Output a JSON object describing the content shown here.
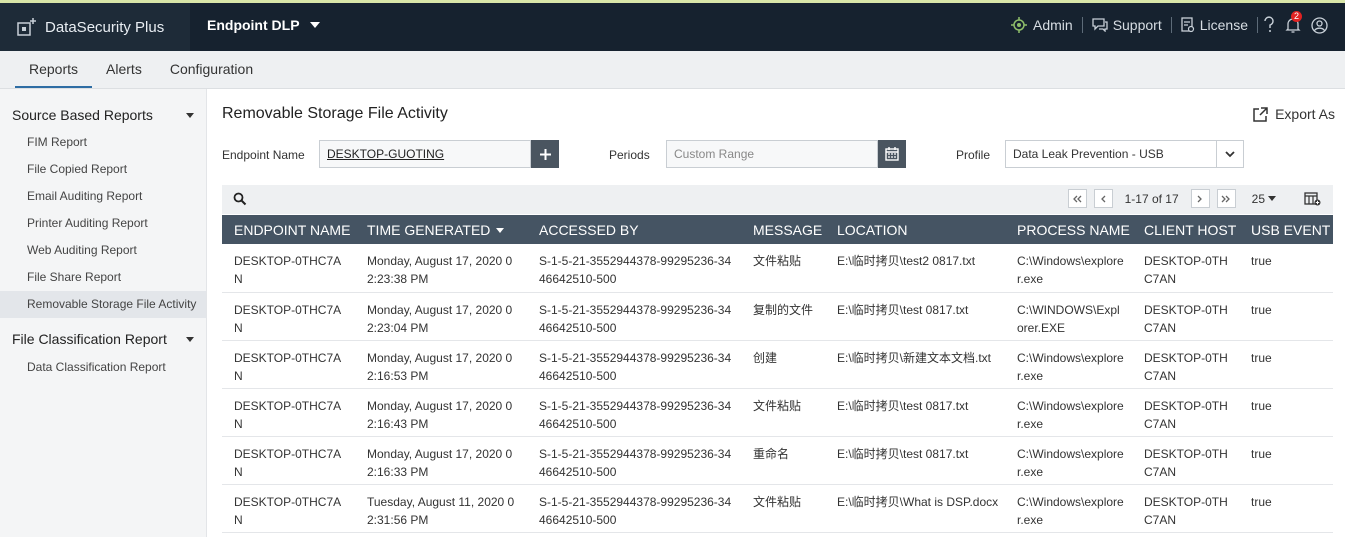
{
  "header": {
    "brand": "DataSecurity Plus",
    "module": "Endpoint DLP",
    "links": [
      {
        "label": "Admin",
        "icon": "admin-gear-icon"
      },
      {
        "label": "Support",
        "icon": "support-chat-icon"
      },
      {
        "label": "License",
        "icon": "license-icon"
      }
    ],
    "notification_count": "2"
  },
  "tabs": [
    {
      "label": "Reports",
      "active": true
    },
    {
      "label": "Alerts",
      "active": false
    },
    {
      "label": "Configuration",
      "active": false
    }
  ],
  "sidebar": {
    "groups": [
      {
        "title": "Source Based Reports",
        "items": [
          {
            "label": "FIM Report"
          },
          {
            "label": "File Copied Report"
          },
          {
            "label": "Email Auditing Report"
          },
          {
            "label": "Printer Auditing Report"
          },
          {
            "label": "Web Auditing Report"
          },
          {
            "label": "File Share Report"
          },
          {
            "label": "Removable Storage File Activity"
          }
        ]
      },
      {
        "title": "File Classification Report",
        "items": [
          {
            "label": "Data Classification Report"
          }
        ]
      }
    ]
  },
  "page": {
    "title": "Removable Storage File Activity",
    "export_label": "Export As"
  },
  "filters": {
    "endpoint_label": "Endpoint Name",
    "endpoint_value": "DESKTOP-GUOTING",
    "periods_label": "Periods",
    "periods_placeholder": "Custom Range",
    "profile_label": "Profile",
    "profile_value": "Data Leak Prevention - USB"
  },
  "pager": {
    "info": "1-17 of 17",
    "page_size": "25"
  },
  "table": {
    "columns": [
      "ENDPOINT NAME",
      "TIME GENERATED",
      "ACCESSED BY",
      "MESSAGE",
      "LOCATION",
      "PROCESS NAME",
      "CLIENT HOST",
      "USB EVENT"
    ],
    "rows": [
      [
        "DESKTOP-0THC7AN",
        "Monday, August 17, 2020 02:23:38 PM",
        "S-1-5-21-3552944378-99295236-3446642510-500",
        "文件粘贴",
        "E:\\临时拷贝\\test2 0817.txt",
        "C:\\Windows\\explorer.exe",
        "DESKTOP-0THC7AN",
        "true"
      ],
      [
        "DESKTOP-0THC7AN",
        "Monday, August 17, 2020 02:23:04 PM",
        "S-1-5-21-3552944378-99295236-3446642510-500",
        "复制的文件",
        "E:\\临时拷贝\\test 0817.txt",
        "C:\\WINDOWS\\Explorer.EXE",
        "DESKTOP-0THC7AN",
        "true"
      ],
      [
        "DESKTOP-0THC7AN",
        "Monday, August 17, 2020 02:16:53 PM",
        "S-1-5-21-3552944378-99295236-3446642510-500",
        "创建",
        "E:\\临时拷贝\\新建文本文档.txt",
        "C:\\Windows\\explorer.exe",
        "DESKTOP-0THC7AN",
        "true"
      ],
      [
        "DESKTOP-0THC7AN",
        "Monday, August 17, 2020 02:16:43 PM",
        "S-1-5-21-3552944378-99295236-3446642510-500",
        "文件粘贴",
        "E:\\临时拷贝\\test 0817.txt",
        "C:\\Windows\\explorer.exe",
        "DESKTOP-0THC7AN",
        "true"
      ],
      [
        "DESKTOP-0THC7AN",
        "Monday, August 17, 2020 02:16:33 PM",
        "S-1-5-21-3552944378-99295236-3446642510-500",
        "重命名",
        "E:\\临时拷贝\\test 0817.txt",
        "C:\\Windows\\explorer.exe",
        "DESKTOP-0THC7AN",
        "true"
      ],
      [
        "DESKTOP-0THC7AN",
        "Tuesday, August 11, 2020 02:31:56 PM",
        "S-1-5-21-3552944378-99295236-3446642510-500",
        "文件粘贴",
        "E:\\临时拷贝\\What is DSP.docx",
        "C:\\Windows\\explorer.exe",
        "DESKTOP-0THC7AN",
        "true"
      ]
    ]
  }
}
